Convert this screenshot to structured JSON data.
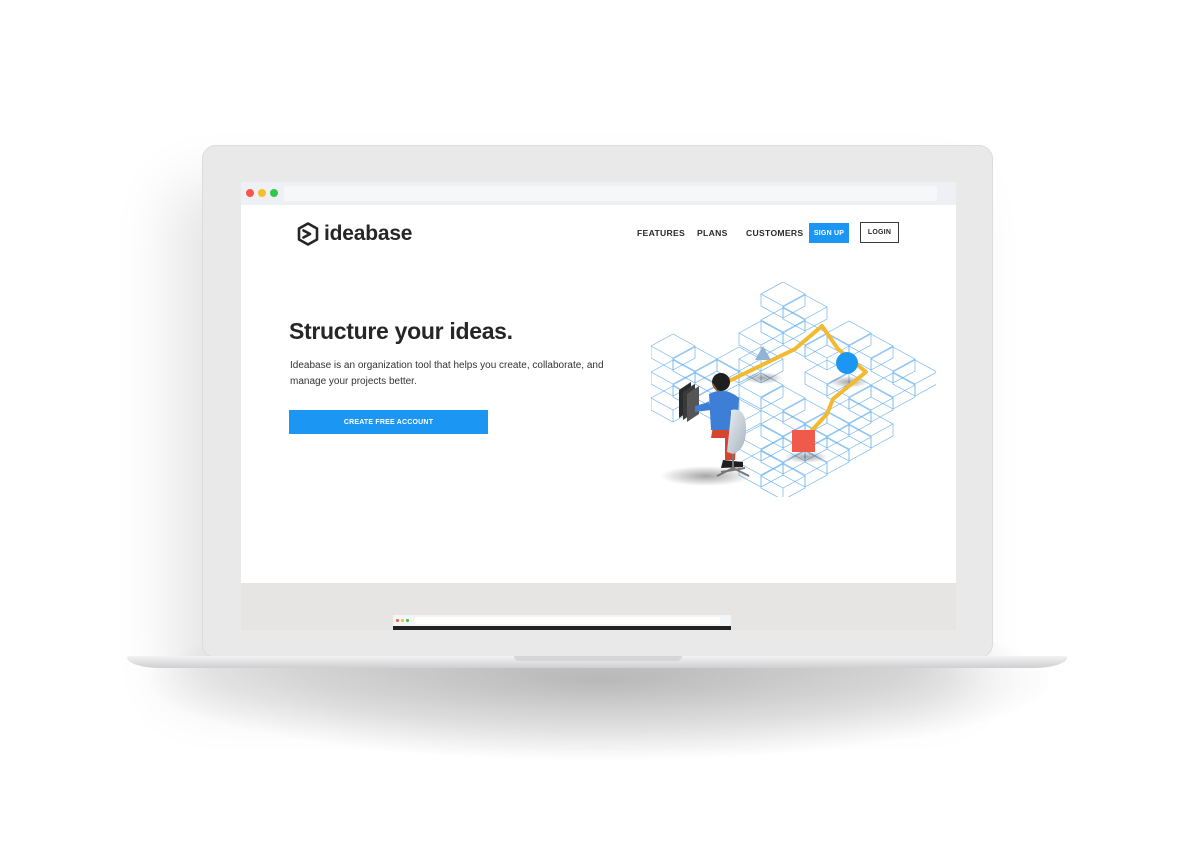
{
  "brand": {
    "name": "ideabase",
    "accent": "#1c96f3",
    "text_color": "#262626"
  },
  "nav": {
    "features": "FEATURES",
    "plans": "PLANS",
    "customers": "CUSTOMERS",
    "signup": "SIGN UP",
    "login": "LOGIN"
  },
  "hero": {
    "title": "Structure your ideas.",
    "description": "Ideabase is an organization tool that helps you create, collaborate, and manage your projects better.",
    "cta": "CREATE FREE ACCOUNT"
  },
  "browser": {
    "traffic_lights": [
      "#f5584a",
      "#f7bd2b",
      "#2ec84a"
    ]
  },
  "illustration": {
    "semantic": "person-at-desk-with-isometric-cube-grid",
    "colors": {
      "grid": "#5aa9ea",
      "path": "#f3b92f",
      "circle": "#1c96f3",
      "square": "#f05a4a",
      "shirt": "#3d7fd6",
      "pants": "#d6452f"
    }
  },
  "icons": [
    "ideabase-logo-icon"
  ]
}
